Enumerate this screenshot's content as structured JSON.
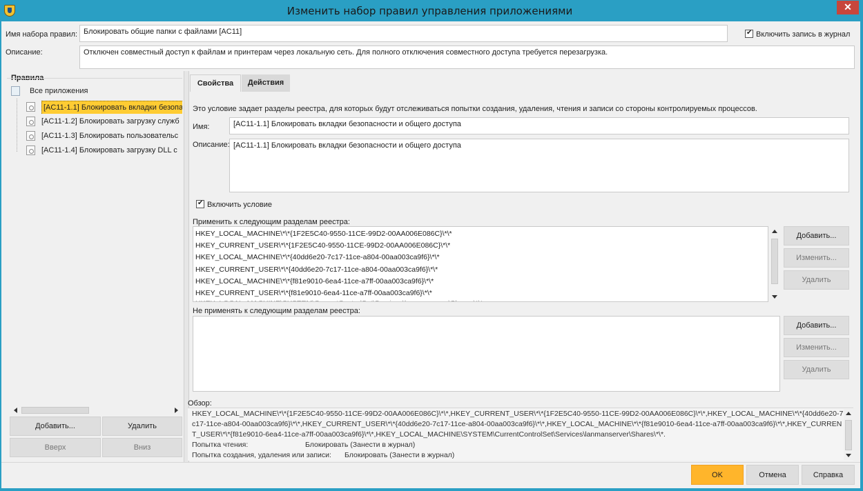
{
  "window": {
    "title": "Изменить набор правил управления приложениями",
    "close_glyph": "✕"
  },
  "header": {
    "name_label": "Имя набора правил:",
    "name_value": "Блокировать общие папки с файлами [AC11]",
    "log_label": "Включить запись в журнал",
    "description_label": "Описание:",
    "description_value": "Отключен совместный доступ к файлам и принтерам через локальную сеть.  Для полного отключения совместного доступа требуется перезагрузка."
  },
  "rules": {
    "group_label": "Правила",
    "root": "Все приложения",
    "items": [
      {
        "label": "[AC11-1.1] Блокировать вкладки безопа",
        "icon": "registry-rule-icon"
      },
      {
        "label": "[AC11-1.2] Блокировать загрузку служб",
        "icon": "service-rule-icon"
      },
      {
        "label": "[AC11-1.3] Блокировать пользовательс",
        "icon": "file-rule-icon"
      },
      {
        "label": "[AC11-1.4] Блокировать загрузку DLL с",
        "icon": "dll-rule-icon"
      }
    ],
    "add_label": "Добавить...",
    "delete_label": "Удалить",
    "up_label": "Вверх",
    "down_label": "Вниз"
  },
  "tabs": [
    {
      "label": "Свойства"
    },
    {
      "label": "Действия"
    }
  ],
  "properties": {
    "intro": "Это условие задает разделы реестра, для которых будут отслеживаться попытки создания, удаления, чтения и записи со стороны контролируемых процессов.",
    "name_label": "Имя:",
    "name_value": "[AC11-1.1] Блокировать вкладки безопасности и общего доступа",
    "desc_label": "Описание:",
    "desc_value": "[AC11-1.1] Блокировать вкладки безопасности и общего доступа",
    "enable_label": "Включить условие",
    "apply_label": "Применить к следующим разделам реестра:",
    "apply_items": [
      "HKEY_LOCAL_MACHINE\\*\\*{1F2E5C40-9550-11CE-99D2-00AA006E086C}\\*\\*",
      "HKEY_CURRENT_USER\\*\\*{1F2E5C40-9550-11CE-99D2-00AA006E086C}\\*\\*",
      "HKEY_LOCAL_MACHINE\\*\\*{40dd6e20-7c17-11ce-a804-00aa003ca9f6}\\*\\*",
      "HKEY_CURRENT_USER\\*\\*{40dd6e20-7c17-11ce-a804-00aa003ca9f6}\\*\\*",
      "HKEY_LOCAL_MACHINE\\*\\*{f81e9010-6ea4-11ce-a7ff-00aa003ca9f6}\\*\\*",
      "HKEY_CURRENT_USER\\*\\*{f81e9010-6ea4-11ce-a7ff-00aa003ca9f6}\\*\\*"
    ],
    "exclude_label": "Не применять к следующим разделам реестра:",
    "add_label": "Добавить...",
    "edit_label": "Изменить...",
    "delete_label": "Удалить",
    "overview_label": "Обзор:",
    "overview_text": "HKEY_LOCAL_MACHINE\\*\\*{1F2E5C40-9550-11CE-99D2-00AA006E086C}\\*\\*,HKEY_CURRENT_USER\\*\\*{1F2E5C40-9550-11CE-99D2-00AA006E086C}\\*\\*,HKEY_LOCAL_MACHINE\\*\\*{40dd6e20-7c17-11ce-a804-00aa003ca9f6}\\*\\*,HKEY_CURRENT_USER\\*\\*{40dd6e20-7c17-11ce-a804-00aa003ca9f6}\\*\\*,HKEY_LOCAL_MACHINE\\*\\*{f81e9010-6ea4-11ce-a7ff-00aa003ca9f6}\\*\\*,HKEY_CURRENT_USER\\*\\*{f81e9010-6ea4-11ce-a7ff-00aa003ca9f6}\\*\\*,HKEY_LOCAL_MACHINE\\SYSTEM\\CurrentControlSet\\Services\\lanmanserver\\Shares\\*\\*.",
    "read_label": "Попытка чтения:",
    "read_value": "Блокировать (Занести в журнал)",
    "write_label": "Попытка создания, удаления или записи:",
    "write_value": "Блокировать (Занести в журнал)"
  },
  "footer": {
    "ok_label": "OK",
    "cancel_label": "Отмена",
    "help_label": "Справка"
  },
  "colors": {
    "title_bar": "#2a9fc4",
    "selection": "#ffcc33",
    "ok_button": "#ffb52b",
    "close_button": "#c7463c"
  }
}
